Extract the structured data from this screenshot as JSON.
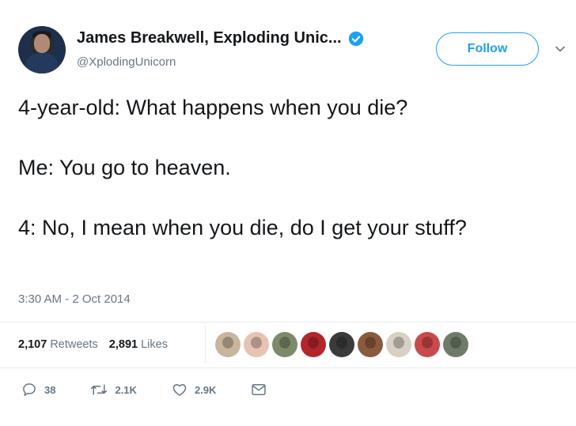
{
  "author": {
    "name": "James Breakwell, Exploding Unic...",
    "handle": "@XplodingUnicorn",
    "verified": true
  },
  "follow_label": "Follow",
  "tweet": {
    "line1": "4-year-old: What happens when you die?",
    "line2": "Me: You go to heaven.",
    "line3": "4: No, I mean when you die, do I get your stuff?"
  },
  "timestamp": "3:30 AM - 2 Oct 2014",
  "stats": {
    "retweets_count": "2,107",
    "retweets_label": "Retweets",
    "likes_count": "2,891",
    "likes_label": "Likes"
  },
  "likers": [
    {
      "icon": "liker-avatar-1",
      "color": "#c9b59c"
    },
    {
      "icon": "liker-avatar-2",
      "color": "#e6c3b3"
    },
    {
      "icon": "liker-avatar-3",
      "color": "#7c8a6a"
    },
    {
      "icon": "liker-avatar-4",
      "color": "#b3262e"
    },
    {
      "icon": "liker-avatar-5",
      "color": "#3b3b3b"
    },
    {
      "icon": "liker-avatar-6",
      "color": "#8a5a3c"
    },
    {
      "icon": "liker-avatar-7",
      "color": "#d9d0c4"
    },
    {
      "icon": "liker-avatar-8",
      "color": "#c94a4a"
    },
    {
      "icon": "liker-avatar-9",
      "color": "#6e7b6a"
    }
  ],
  "actions": {
    "reply_count": "38",
    "retweet_count": "2.1K",
    "like_count": "2.9K"
  },
  "colors": {
    "accent": "#1da1f2",
    "text": "#14171a",
    "muted": "#657786",
    "divider": "#e6ecf0"
  }
}
